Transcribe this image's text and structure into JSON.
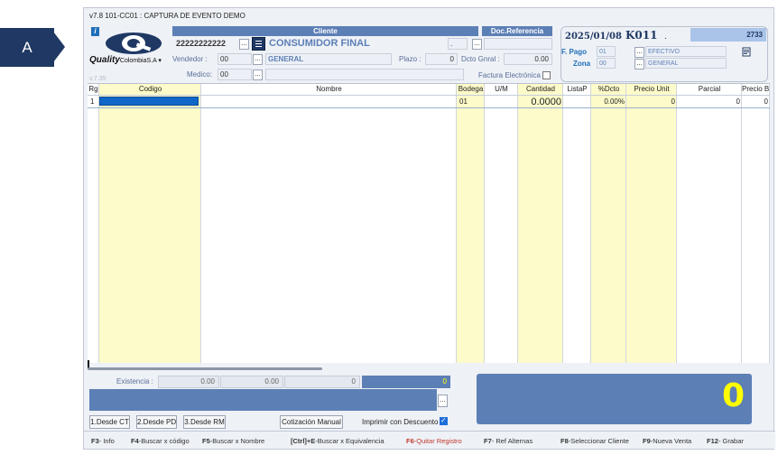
{
  "marker": {
    "label": "A"
  },
  "window": {
    "title": "v7.8 101-CC01 : CAPTURA DE EVENTO DEMO"
  },
  "brand": {
    "name": "Quality",
    "suffix": "ColombiaS.A",
    "version": "v.7.35"
  },
  "cliente": {
    "header": "Cliente",
    "nit": "22222222222",
    "name": "CONSUMIDOR FINAL",
    "vendedor_label": "Vendedor :",
    "vendedor_code": "00",
    "vendedor_name": "GENERAL",
    "medico_label": "Medico:",
    "medico_code": "00",
    "plazo_label": "Plazo :",
    "plazo_value": "0",
    "dcto_label": "Dcto Gnral :",
    "dcto_value": "0.00",
    "factura_label": "Factura Electrónica",
    "ellipsis": "...",
    "dot": "."
  },
  "doc_referencia": {
    "header": "Doc.Referencia"
  },
  "document": {
    "date": "2025/01/08",
    "code": "K011",
    "dot": ".",
    "number": "2733",
    "fpago_label": "F. Pago",
    "fpago_code": "01",
    "fpago_name": "EFECTIVO",
    "zona_label": "Zona",
    "zona_code": "00",
    "zona_name": "GENERAL"
  },
  "grid": {
    "headers": [
      "Rg",
      "Codigo",
      "Nombre",
      "Bodega",
      "U/M",
      "Cantidad",
      "ListaP",
      "%Dcto",
      "Precio Unit",
      "Parcial",
      "Precio B"
    ],
    "row": {
      "rg": "1",
      "bodega": "01",
      "cantidad": "0.0000",
      "dcto": "0.00%",
      "precio_unit": "0",
      "parcial": "0",
      "precio_b": "0"
    }
  },
  "footer": {
    "existencia_label": "Existencia :",
    "exist_1": "0.00",
    "exist_2": "0.00",
    "exist_3": "0",
    "exist_4": "0",
    "total": "0",
    "btn_desde_ct": "1.Desde CT",
    "btn_desde_pd": "2.Desde PD",
    "btn_desde_rm": "3.Desde RM",
    "btn_cotizacion": "Cotización Manual",
    "imprimir_label": "Imprimir con Descuento",
    "ellipsis": "..."
  },
  "fkeys": [
    {
      "key": "F3",
      "label": "- Info"
    },
    {
      "key": "F4",
      "label": "-Buscar x código"
    },
    {
      "key": "F5",
      "label": "-Buscar x Nombre"
    },
    {
      "key": "[Ctrl]+E",
      "label": "-Buscar x Equivalencia"
    },
    {
      "key": "F6",
      "label": "-Quitar Registro"
    },
    {
      "key": "F7",
      "label": "- Ref Alternas"
    },
    {
      "key": "F8",
      "label": "-Seleccionar Cliente"
    },
    {
      "key": "F9",
      "label": "-Nueva Venta"
    },
    {
      "key": "F12",
      "label": "- Grabar"
    }
  ]
}
